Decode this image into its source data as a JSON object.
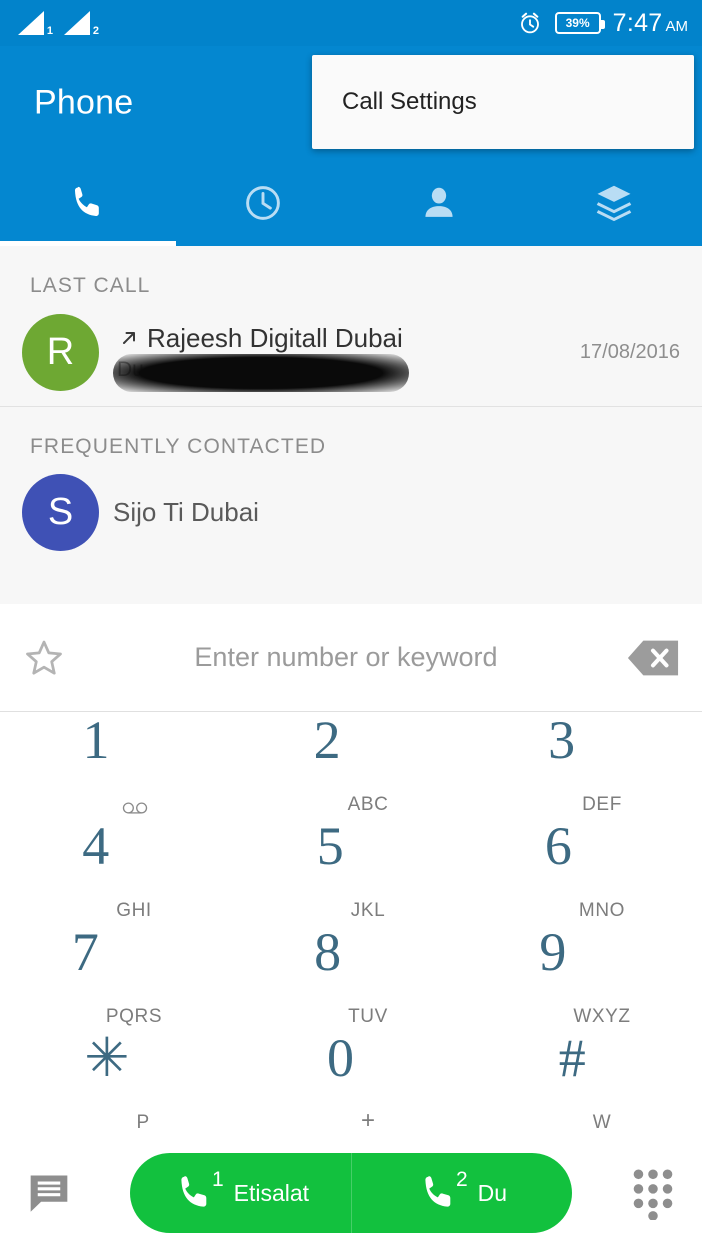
{
  "status_bar": {
    "sim1_label": "1",
    "sim2_label": "2",
    "alarm_icon": "alarm-clock-icon",
    "battery_percent": "39%",
    "time": "7:47",
    "meridiem": "AM"
  },
  "app_bar": {
    "title": "Phone",
    "menu_item": "Call Settings"
  },
  "tabs": [
    {
      "name": "tab-dialer",
      "icon": "phone-handset-icon",
      "active": true
    },
    {
      "name": "tab-history",
      "icon": "clock-icon",
      "active": false
    },
    {
      "name": "tab-contacts",
      "icon": "person-icon",
      "active": false
    },
    {
      "name": "tab-groups",
      "icon": "layers-stack-icon",
      "active": false
    }
  ],
  "last_call": {
    "section_title": "LAST CALL",
    "avatar_letter": "R",
    "avatar_color": "#6EA833",
    "call_direction_icon": "outgoing-call-arrow-icon",
    "name": "Rajeesh Digitall Dubai",
    "subtitle": "Du",
    "date": "17/08/2016"
  },
  "frequently_contacted": {
    "section_title": "FREQUENTLY CONTACTED",
    "avatar_letter": "S",
    "avatar_color": "#3F51B5",
    "name": "Sijo Ti Dubai"
  },
  "search": {
    "star_icon": "star-outline-icon",
    "placeholder": "Enter number or keyword",
    "value": "",
    "delete_icon": "backspace-delete-icon"
  },
  "keypad": {
    "digit_color": "#3D6A82",
    "rows": [
      [
        {
          "digit": "1",
          "sub": "",
          "icon": "voicemail-icon"
        },
        {
          "digit": "2",
          "sub": "ABC",
          "icon": ""
        },
        {
          "digit": "3",
          "sub": "DEF",
          "icon": ""
        }
      ],
      [
        {
          "digit": "4",
          "sub": "GHI",
          "icon": ""
        },
        {
          "digit": "5",
          "sub": "JKL",
          "icon": ""
        },
        {
          "digit": "6",
          "sub": "MNO",
          "icon": ""
        }
      ],
      [
        {
          "digit": "7",
          "sub": "PQRS",
          "icon": ""
        },
        {
          "digit": "8",
          "sub": "TUV",
          "icon": ""
        },
        {
          "digit": "9",
          "sub": "WXYZ",
          "icon": ""
        }
      ],
      [
        {
          "digit": "✳",
          "sub": "P",
          "icon": ""
        },
        {
          "digit": "0",
          "sub": "+",
          "icon": ""
        },
        {
          "digit": "#",
          "sub": "W",
          "icon": ""
        }
      ]
    ]
  },
  "bottom_bar": {
    "message_icon": "message-bubble-icon",
    "dialpad_icon": "dialpad-dots-icon",
    "call_button_color": "#12C13E",
    "sim1": {
      "number": "1",
      "label": "Etisalat",
      "icon": "phone-handset-icon"
    },
    "sim2": {
      "number": "2",
      "label": "Du",
      "icon": "phone-handset-icon"
    }
  }
}
